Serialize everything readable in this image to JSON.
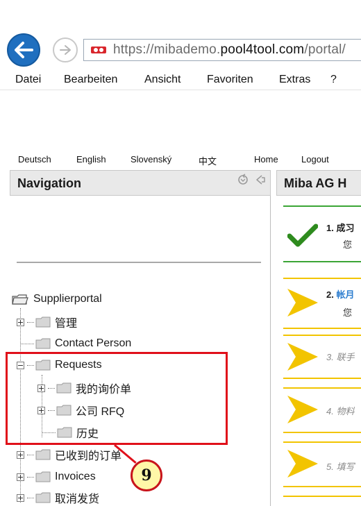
{
  "browser": {
    "url_prefix": "https://",
    "url_sub": "mibademo.",
    "url_domain": "pool4tool.com",
    "url_path": "/portal/",
    "menu": [
      "Datei",
      "Bearbeiten",
      "Ansicht",
      "Favoriten",
      "Extras",
      "?"
    ]
  },
  "lang_links": [
    "Deutsch",
    "English",
    "Slovenský",
    "中文"
  ],
  "top_links": [
    "Home",
    "Logout"
  ],
  "navigation": {
    "title": "Navigation",
    "root": "Supplierportal",
    "items": [
      {
        "label": "管理",
        "expander": "plus"
      },
      {
        "label": "Contact Person",
        "expander": "none"
      },
      {
        "label": "Requests",
        "expander": "minus"
      },
      {
        "label": "我的询价单",
        "expander": "plus"
      },
      {
        "label": "公司 RFQ",
        "expander": "plus"
      },
      {
        "label": "历史",
        "expander": "none"
      },
      {
        "label": "已收到的订单",
        "expander": "plus"
      },
      {
        "label": "Invoices",
        "expander": "plus"
      },
      {
        "label": "取消发货",
        "expander": "plus"
      }
    ]
  },
  "main": {
    "title": "Miba AG H",
    "steps": [
      {
        "num": "1.",
        "label": "成习",
        "sub": "您",
        "status": "done"
      },
      {
        "num": "2.",
        "label": "帐月",
        "sub": "您",
        "status": "active"
      },
      {
        "num": "3.",
        "label": "联手",
        "status": "pending"
      },
      {
        "num": "4.",
        "label": "物料",
        "status": "pending"
      },
      {
        "num": "5.",
        "label": "填写",
        "status": "pending"
      }
    ]
  },
  "callout": {
    "number": "9"
  },
  "colors": {
    "accent": "#1f6fbf",
    "highlight": "#e0101a",
    "check": "#2e8b1e",
    "arrow": "#f2c400"
  }
}
